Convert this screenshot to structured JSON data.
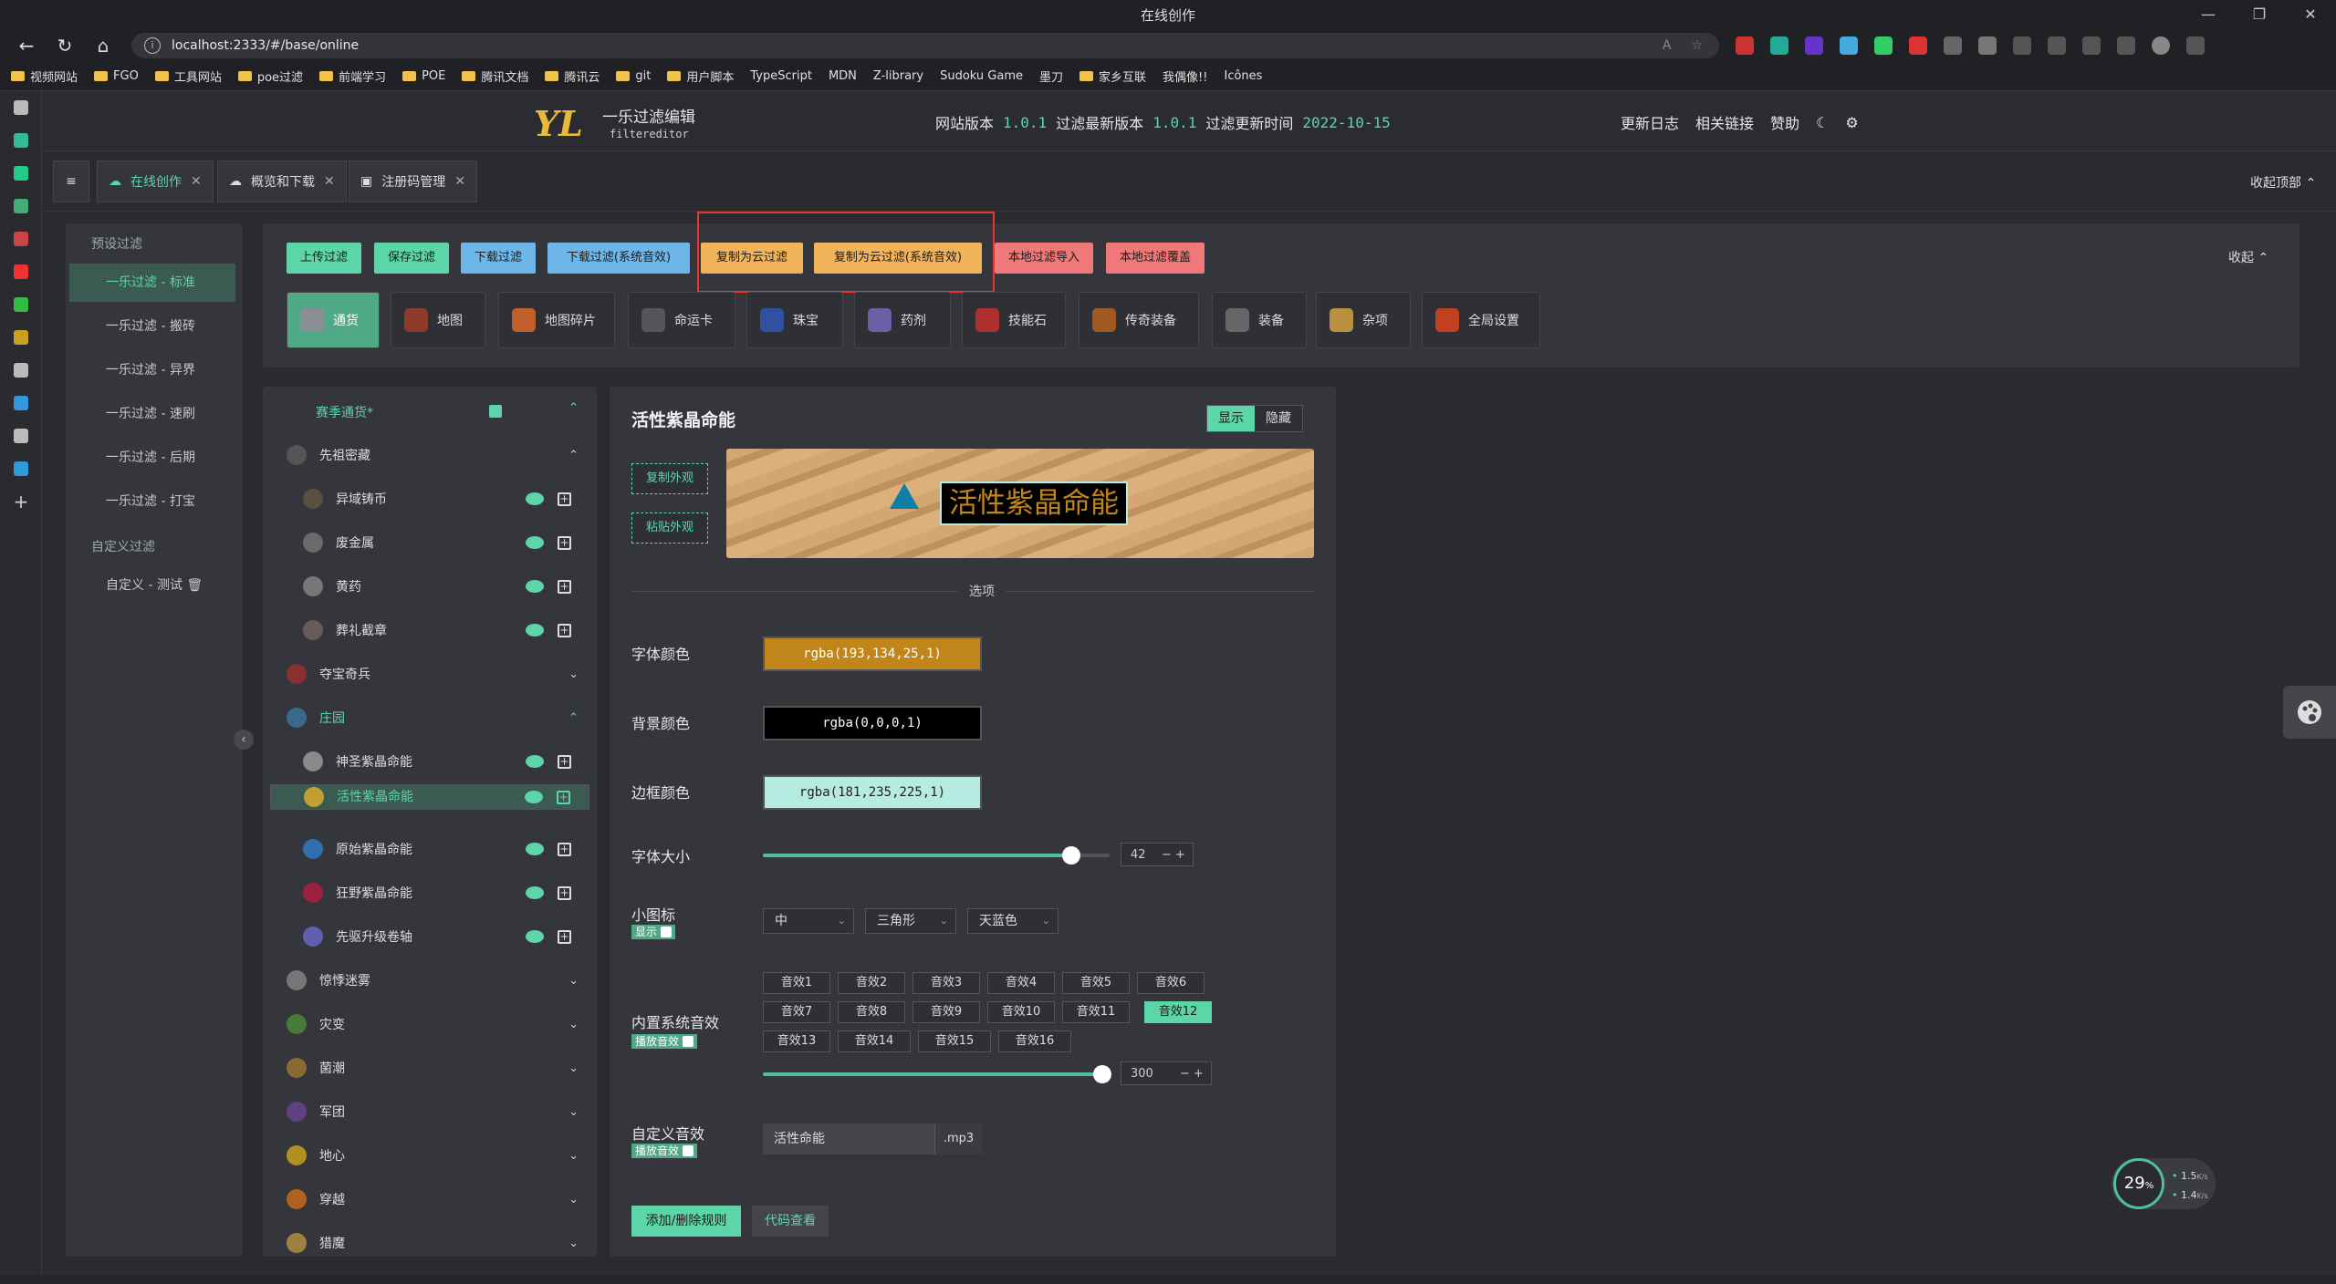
{
  "browser": {
    "window_title": "在线创作",
    "url": "localhost:2333/#/base/online",
    "bookmarks": [
      "视频网站",
      "FGO",
      "工具网站",
      "poe过滤",
      "前端学习",
      "POE",
      "腾讯文档",
      "腾讯云",
      "git",
      "用户脚本",
      "TypeScript",
      "MDN",
      "Z-library",
      "Sudoku Game",
      "墨刀",
      "家乡互联",
      "我偶像!!",
      "Icônes"
    ]
  },
  "header": {
    "logo": "YL",
    "brand": "一乐过滤编辑",
    "brand_sub": "filtereditor",
    "site_version_label": "网站版本",
    "site_version": "1.0.1",
    "filter_version_label": "过滤最新版本",
    "filter_version": "1.0.1",
    "update_time_label": "过滤更新时间",
    "update_time": "2022-10-15",
    "links": [
      "更新日志",
      "相关链接",
      "赞助"
    ]
  },
  "tabs": [
    {
      "label": "在线创作",
      "active": true
    },
    {
      "label": "概览和下载"
    },
    {
      "label": "注册码管理"
    }
  ],
  "collapse_top": "收起顶部",
  "presets": {
    "heading1": "预设过滤",
    "items": [
      "一乐过滤 - 标准",
      "一乐过滤 - 搬砖",
      "一乐过滤 - 异界",
      "一乐过滤 - 速刷",
      "一乐过滤 - 后期",
      "一乐过滤 - 打宝"
    ],
    "heading2": "自定义过滤",
    "custom_items": [
      "自定义 - 测试"
    ]
  },
  "toolbar": {
    "buttons": [
      {
        "label": "上传过滤",
        "color": "green"
      },
      {
        "label": "保存过滤",
        "color": "green"
      },
      {
        "label": "下载过滤",
        "color": "blue"
      },
      {
        "label": "下载过滤(系统音效)",
        "color": "blue"
      },
      {
        "label": "复制为云过滤",
        "color": "orange"
      },
      {
        "label": "复制为云过滤(系统音效)",
        "color": "orange"
      },
      {
        "label": "本地过滤导入",
        "color": "red"
      },
      {
        "label": "本地过滤覆盖",
        "color": "red"
      }
    ],
    "collapse": "收起",
    "categories": [
      "通货",
      "地图",
      "地图碎片",
      "命运卡",
      "珠宝",
      "药剂",
      "技能石",
      "传奇装备",
      "装备",
      "杂项",
      "全局设置"
    ]
  },
  "tree": {
    "root": "赛季通货*",
    "nodes": [
      {
        "label": "先祖密藏",
        "level": 0,
        "expanded": true
      },
      {
        "label": "异域铸币",
        "level": 1
      },
      {
        "label": "废金属",
        "level": 1
      },
      {
        "label": "黄药",
        "level": 1
      },
      {
        "label": "葬礼截章",
        "level": 1
      },
      {
        "label": "夺宝奇兵",
        "level": 0
      },
      {
        "label": "庄园",
        "level": 0,
        "expanded": true,
        "active": true
      },
      {
        "label": "神圣紫晶命能",
        "level": 1
      },
      {
        "label": "活性紫晶命能",
        "level": 1,
        "selected": true
      },
      {
        "label": "原始紫晶命能",
        "level": 1
      },
      {
        "label": "狂野紫晶命能",
        "level": 1
      },
      {
        "label": "先驱升级卷轴",
        "level": 1
      },
      {
        "label": "惊悸迷雾",
        "level": 0
      },
      {
        "label": "灾变",
        "level": 0
      },
      {
        "label": "菌潮",
        "level": 0
      },
      {
        "label": "军团",
        "level": 0
      },
      {
        "label": "地心",
        "level": 0
      },
      {
        "label": "穿越",
        "level": 0
      },
      {
        "label": "猎魔",
        "level": 0
      }
    ]
  },
  "editor": {
    "title": "活性紫晶命能",
    "show": "显示",
    "hide": "隐藏",
    "copy_look": "复制外观",
    "paste_look": "粘贴外观",
    "preview_text": "活性紫晶命能",
    "options": "选项",
    "font_color_label": "字体颜色",
    "font_color": "rgba(193,134,25,1)",
    "bg_color_label": "背景颜色",
    "bg_color": "rgba(0,0,0,1)",
    "border_color_label": "边框颜色",
    "border_color": "rgba(181,235,225,1)",
    "font_size_label": "字体大小",
    "font_size": "42",
    "icon_label": "小图标",
    "icon_badge": "显示",
    "icon_size": "中",
    "icon_shape": "三角形",
    "icon_color": "天蓝色",
    "sound_label": "内置系统音效",
    "sound_badge": "播放音效",
    "sounds": [
      "音效1",
      "音效2",
      "音效3",
      "音效4",
      "音效5",
      "音效6",
      "音效7",
      "音效8",
      "音效9",
      "音效10",
      "音效11",
      "音效12",
      "音效13",
      "音效14",
      "音效15",
      "音效16"
    ],
    "sound_selected": "音效12",
    "volume": "300",
    "custom_sound_label": "自定义音效",
    "custom_badge": "播放音效",
    "custom_file": "活性命能",
    "custom_ext": ".mp3",
    "rule_btn": "添加/删除规则",
    "code_btn": "代码查看"
  },
  "net": {
    "percent": "29",
    "unit": "%",
    "up": "1.5",
    "up_unit": "K/s",
    "down": "1.4",
    "down_unit": "K/s"
  },
  "colors": {
    "accent": "#5cd6a8",
    "font_color": "#c18619",
    "border_color": "#b5ebe1"
  }
}
